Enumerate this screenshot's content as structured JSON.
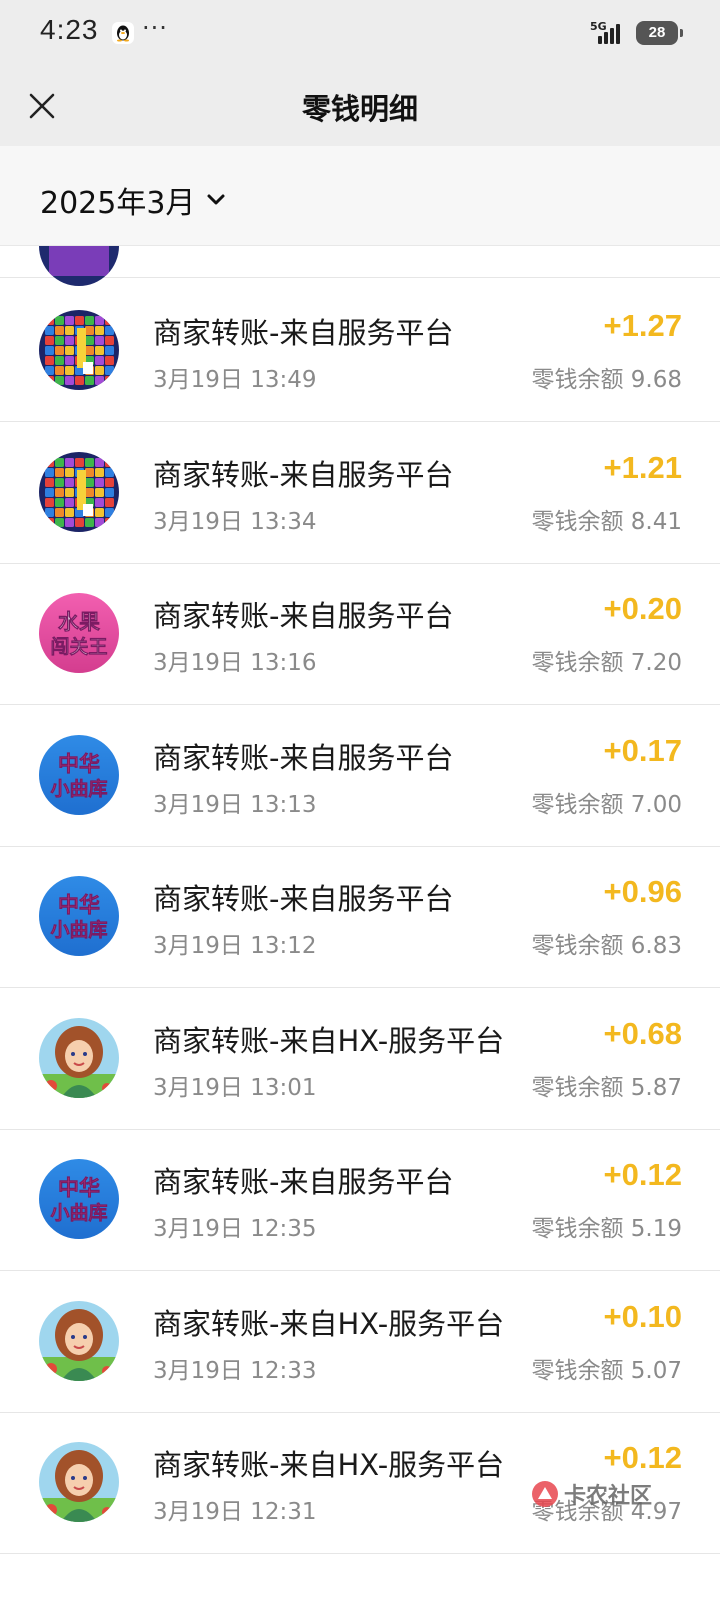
{
  "status_bar": {
    "time": "4:23",
    "more": "···",
    "network": "5G",
    "battery": "28"
  },
  "header": {
    "title": "零钱明细"
  },
  "filter": {
    "month_label": "2025年3月"
  },
  "transactions": [
    {
      "title": "商家转账-来自服务平台",
      "time": "3月19日 13:49",
      "amount": "+1.27",
      "balance": "零钱余额 9.68",
      "avatar": "block-puzzle-game-icon"
    },
    {
      "title": "商家转账-来自服务平台",
      "time": "3月19日 13:34",
      "amount": "+1.21",
      "balance": "零钱余额 8.41",
      "avatar": "block-puzzle-game-icon"
    },
    {
      "title": "商家转账-来自服务平台",
      "time": "3月19日 13:16",
      "amount": "+0.20",
      "balance": "零钱余额 7.20",
      "avatar": "fruit-game-icon",
      "avatar_text": [
        "水果",
        "闯关王"
      ]
    },
    {
      "title": "商家转账-来自服务平台",
      "time": "3月19日 13:13",
      "amount": "+0.17",
      "balance": "零钱余额 7.00",
      "avatar": "music-library-icon",
      "avatar_text": [
        "中华",
        "小曲库"
      ]
    },
    {
      "title": "商家转账-来自服务平台",
      "time": "3月19日 13:12",
      "amount": "+0.96",
      "balance": "零钱余额 6.83",
      "avatar": "music-library-icon",
      "avatar_text": [
        "中华",
        "小曲库"
      ]
    },
    {
      "title": "商家转账-来自HX-服务平台",
      "time": "3月19日 13:01",
      "amount": "+0.68",
      "balance": "零钱余额 5.87",
      "avatar": "farm-girl-game-icon"
    },
    {
      "title": "商家转账-来自服务平台",
      "time": "3月19日 12:35",
      "amount": "+0.12",
      "balance": "零钱余额 5.19",
      "avatar": "music-library-icon",
      "avatar_text": [
        "中华",
        "小曲库"
      ]
    },
    {
      "title": "商家转账-来自HX-服务平台",
      "time": "3月19日 12:33",
      "amount": "+0.10",
      "balance": "零钱余额 5.07",
      "avatar": "farm-girl-game-icon"
    },
    {
      "title": "商家转账-来自HX-服务平台",
      "time": "3月19日 12:31",
      "amount": "+0.12",
      "balance": "零钱余额 4.97",
      "avatar": "farm-girl-game-icon"
    }
  ],
  "watermark": {
    "text": "卡农社区"
  },
  "colors": {
    "amount": "#f3b81f",
    "header_bg": "#ededed",
    "filter_bg": "#f7f7f7",
    "secondary_text": "#8a8a8a"
  }
}
